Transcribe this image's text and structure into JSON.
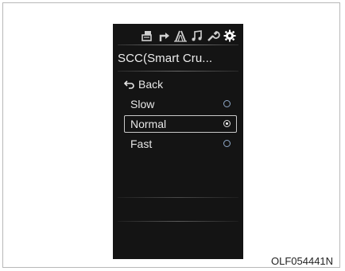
{
  "icons": [
    "trip-computer-icon",
    "turn-by-turn-icon",
    "lane-assist-icon",
    "audio-icon",
    "wrench-icon",
    "gear-icon"
  ],
  "menu": {
    "title": "SCC(Smart Cru...",
    "back_label": "Back",
    "options": [
      {
        "label": "Slow",
        "selected": false
      },
      {
        "label": "Normal",
        "selected": true
      },
      {
        "label": "Fast",
        "selected": false
      }
    ]
  },
  "figure_code": "OLF054441N"
}
